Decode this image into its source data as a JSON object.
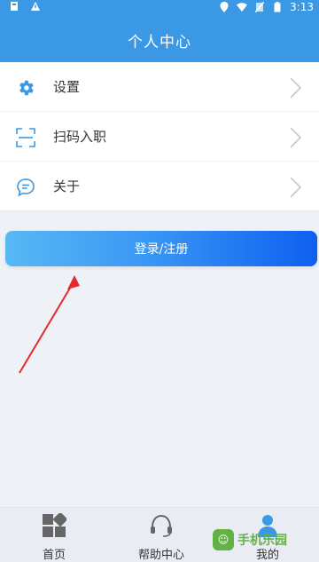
{
  "status_bar": {
    "time": "3:13",
    "left_icons": [
      "storage-icon",
      "warning-icon"
    ],
    "right_icons": [
      "location-icon",
      "wifi-icon",
      "no-sim-icon",
      "battery-icon"
    ]
  },
  "header": {
    "title": "个人中心",
    "color": "#3a98e4"
  },
  "menu": {
    "items": [
      {
        "label": "设置",
        "icon": "gear-icon"
      },
      {
        "label": "扫码入职",
        "icon": "scan-icon"
      },
      {
        "label": "关于",
        "icon": "chat-bubble-icon"
      }
    ]
  },
  "login_button": {
    "label": "登录/注册"
  },
  "tabs": [
    {
      "label": "首页",
      "icon": "home-grid-icon"
    },
    {
      "label": "帮助中心",
      "icon": "headset-icon"
    },
    {
      "label": "我的",
      "icon": "profile-icon"
    }
  ],
  "watermark": {
    "text": "手机乐园"
  }
}
